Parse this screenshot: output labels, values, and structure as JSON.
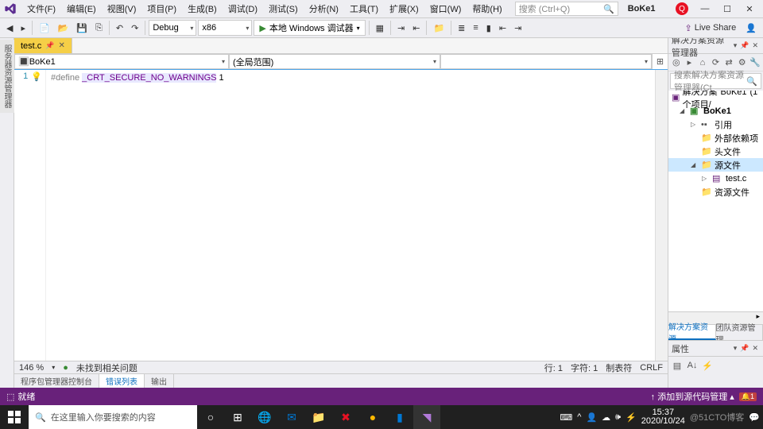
{
  "menu": {
    "items": [
      "文件(F)",
      "编辑(E)",
      "视图(V)",
      "项目(P)",
      "生成(B)",
      "调试(D)",
      "测试(S)",
      "分析(N)",
      "工具(T)",
      "扩展(X)",
      "窗口(W)",
      "帮助(H)"
    ]
  },
  "search": {
    "placeholder": "搜索 (Ctrl+Q)"
  },
  "project": {
    "name": "BoKe1"
  },
  "toolbar": {
    "config": "Debug",
    "platform": "x86",
    "start": "本地 Windows 调试器",
    "liveshare": "Live Share"
  },
  "tab": {
    "file": "test.c"
  },
  "combos": {
    "scope": "BoKe1",
    "view": "(全局范围)"
  },
  "code": {
    "line": "1",
    "directive": "#define ",
    "macro": "_CRT_SECURE_NO_WARNINGS",
    "tail": " 1"
  },
  "editorFooter": {
    "zoom": "146 %",
    "issues": "未找到相关问题",
    "line": "行: 1",
    "char": "字符: 1",
    "tabs": "制表符",
    "crlf": "CRLF"
  },
  "solution": {
    "title": "解决方案资源管理器",
    "search": "搜索解决方案资源管理器(Ct",
    "root": "解决方案\"BoKe1\"(1 个项目/",
    "project": "BoKe1",
    "nodes": {
      "refs": "引用",
      "ext": "外部依赖项",
      "headers": "头文件",
      "sources": "源文件",
      "file": "test.c",
      "res": "资源文件"
    },
    "tabs": {
      "sol": "解决方案资源...",
      "team": "团队资源管理..."
    }
  },
  "properties": {
    "title": "属性"
  },
  "bottomTabs": {
    "pkg": "程序包管理器控制台",
    "errors": "错误列表",
    "output": "输出"
  },
  "status": {
    "ready": "就绪",
    "addSrc": "添加到源代码管理"
  },
  "taskbar": {
    "search": "在这里输入你要搜索的内容",
    "time": "15:37",
    "date": "2020/10/24",
    "watermark": "@51CTO博客"
  }
}
